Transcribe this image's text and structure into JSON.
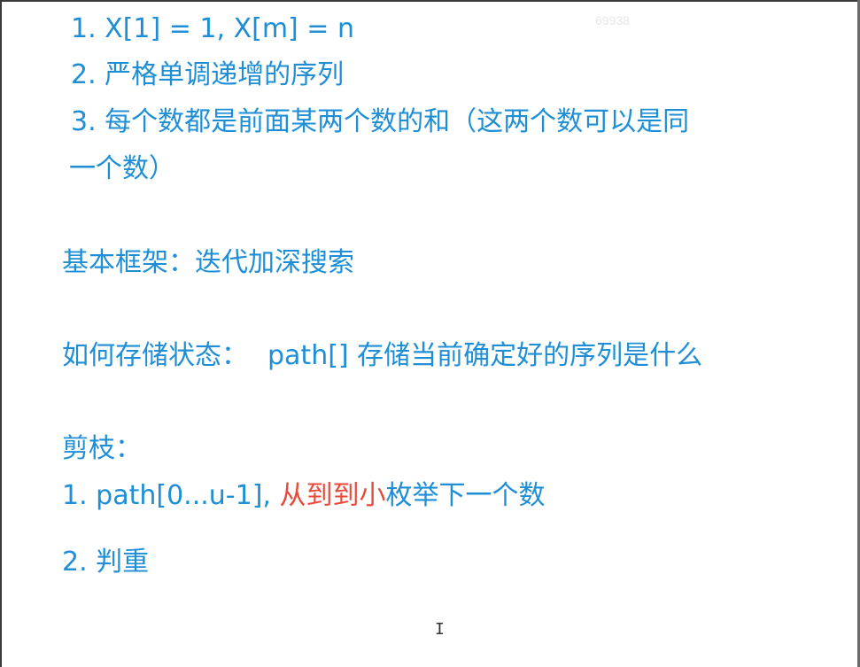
{
  "conditions": {
    "c1": "1. X[1] = 1, X[m] = n",
    "c2": "2. 严格单调递增的序列",
    "c3a": "3. 每个数都是前面某两个数的和（这两个数可以是同",
    "c3b": "一个数）"
  },
  "framework": {
    "text": "基本框架：迭代加深搜索"
  },
  "state": {
    "label": "如何存储状态：",
    "text": "path[] 存储当前确定好的序列是什么"
  },
  "pruning": {
    "title": "剪枝：",
    "p1_prefix": "1. path[0...u-1], ",
    "p1_highlight": "从到到小",
    "p1_suffix": "枚举下一个数",
    "p2": "2. 判重"
  },
  "watermark": "69938",
  "colors": {
    "text": "#1e8fd6",
    "highlight": "#e84a3a"
  },
  "cursor_icon": "text-cursor-icon"
}
